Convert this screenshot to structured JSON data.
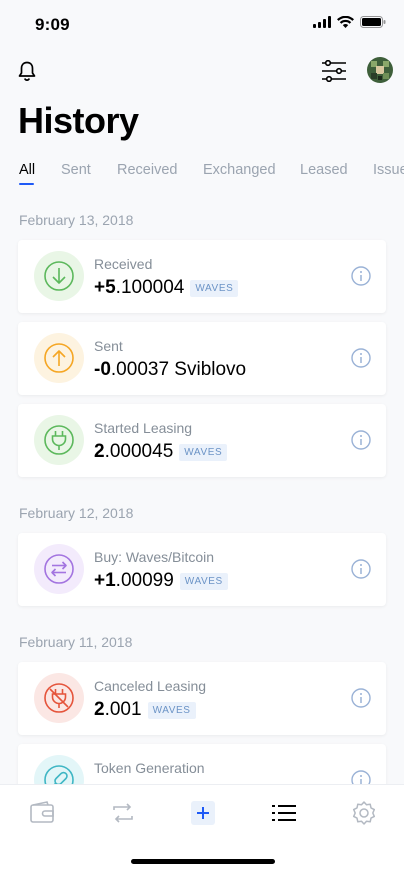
{
  "status": {
    "time": "9:09"
  },
  "page": {
    "title": "History"
  },
  "tabs": [
    "All",
    "Sent",
    "Received",
    "Exchanged",
    "Leased",
    "Issued"
  ],
  "groups": [
    {
      "date": "February 13, 2018",
      "items": [
        {
          "type": "received",
          "label": "Received",
          "amount_main": "+5",
          "amount_rest": ".100004",
          "badge": "WAVES",
          "icon": "arrow-down-icon",
          "color": "#5cb85c"
        },
        {
          "type": "sent",
          "label": "Sent",
          "amount_main": "-0",
          "amount_rest": ".00037 Sviblovo",
          "badge": "",
          "icon": "arrow-up-icon",
          "color": "#f5a623"
        },
        {
          "type": "leasing",
          "label": "Started Leasing",
          "amount_main": "2",
          "amount_rest": ".000045",
          "badge": "WAVES",
          "icon": "plug-icon",
          "color": "#5cb85c"
        }
      ]
    },
    {
      "date": "February 12, 2018",
      "items": [
        {
          "type": "exchange",
          "label": "Buy: Waves/Bitcoin",
          "amount_main": "+1",
          "amount_rest": ".00099",
          "badge": "WAVES",
          "icon": "exchange-icon",
          "color": "#a374e0"
        }
      ]
    },
    {
      "date": "February 11, 2018",
      "items": [
        {
          "type": "cancel-leasing",
          "label": "Canceled Leasing",
          "amount_main": "2",
          "amount_rest": ".001",
          "badge": "WAVES",
          "icon": "plug-cancel-icon",
          "color": "#e5543b"
        },
        {
          "type": "token",
          "label": "Token Generation",
          "amount_main": "",
          "amount_rest": "",
          "badge": "",
          "icon": "token-icon",
          "color": "#3fb6c4"
        }
      ]
    }
  ],
  "bottom_nav": [
    "wallet-icon",
    "transfer-icon",
    "plus-icon",
    "history-icon",
    "settings-icon"
  ],
  "colors": {
    "accent": "#1f5af6",
    "muted": "#9ba4b0"
  }
}
